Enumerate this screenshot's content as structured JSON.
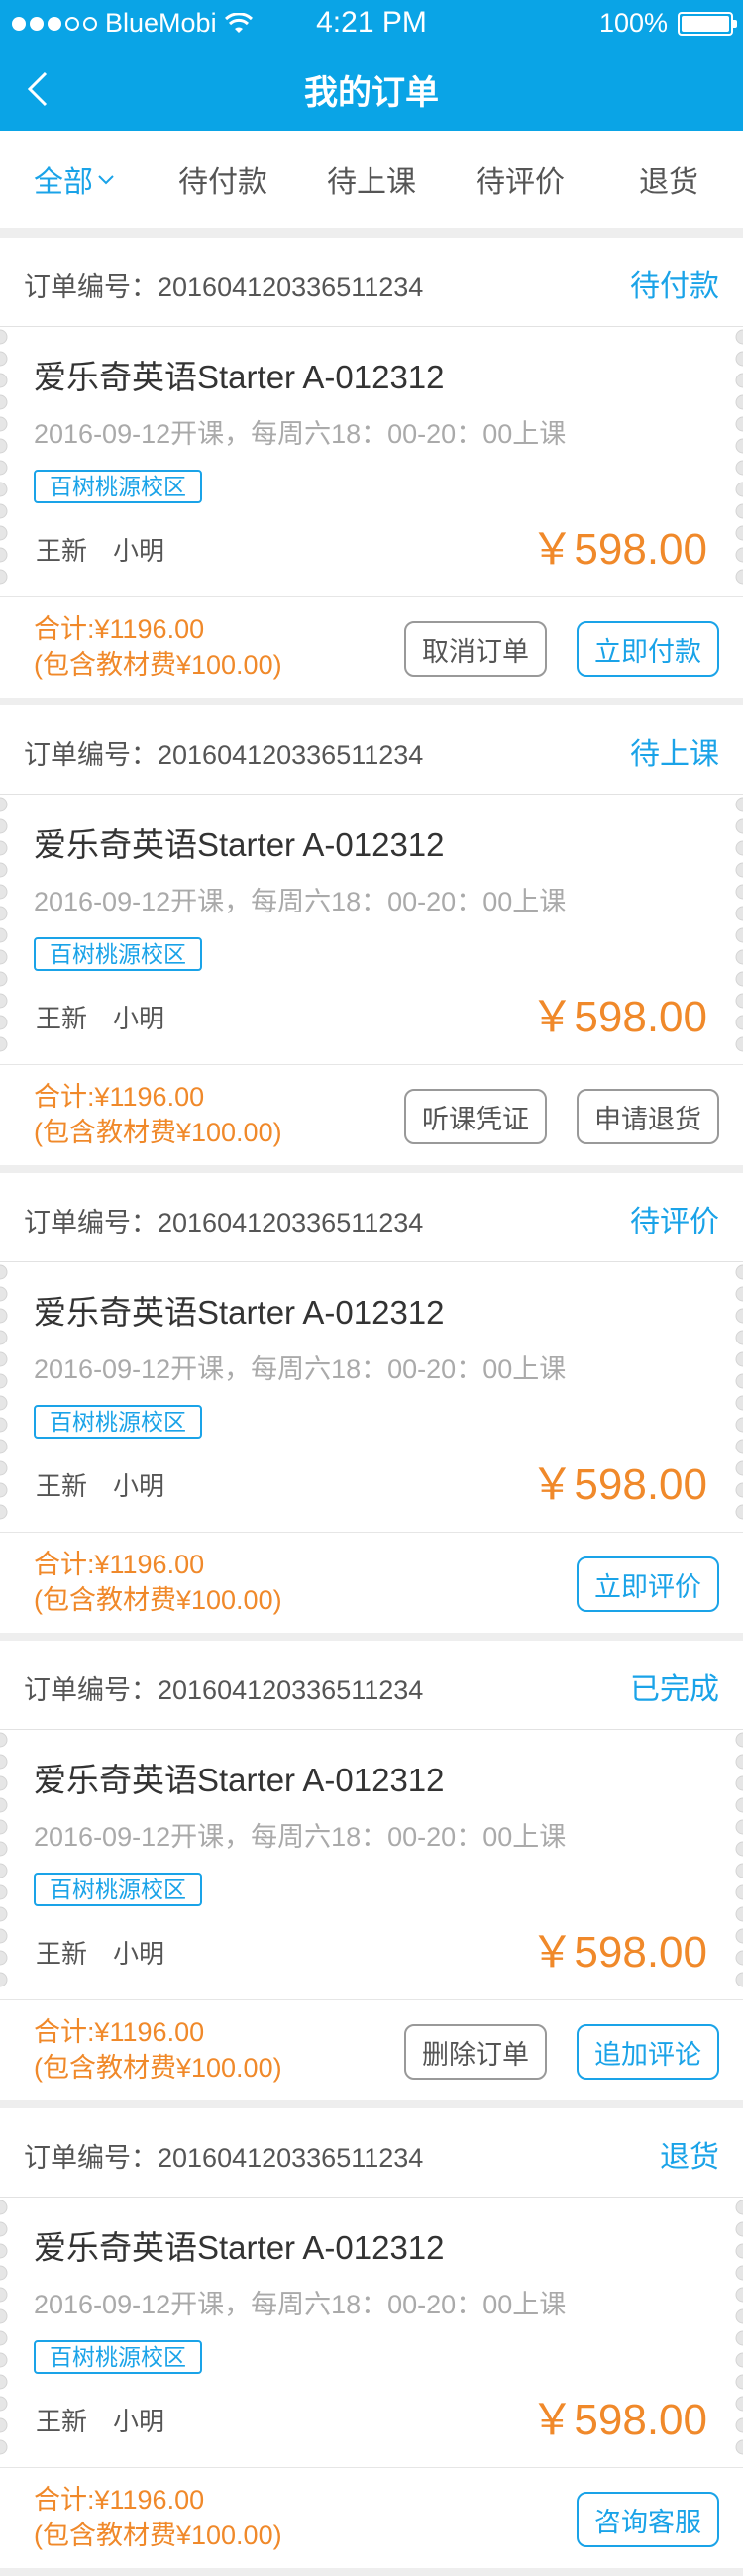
{
  "status_bar": {
    "carrier": "BlueMobi",
    "time": "4:21 PM",
    "battery": "100%"
  },
  "navbar": {
    "title": "我的订单"
  },
  "tabs": [
    {
      "label": "全部",
      "active": true
    },
    {
      "label": "待付款",
      "active": false
    },
    {
      "label": "待上课",
      "active": false
    },
    {
      "label": "待评价",
      "active": false
    },
    {
      "label": "退货",
      "active": false
    }
  ],
  "orders": [
    {
      "number_label": "订单编号：201604120336511234",
      "status": "待付款",
      "course": "爱乐奇英语Starter A-012312",
      "schedule": "2016-09-12开课，每周六18：00-20：00上课",
      "campus": "百树桃源校区",
      "teacher": "王新",
      "student": "小明",
      "price": "￥598.00",
      "total": "合计:¥1196.00",
      "material": "(包含教材费¥100.00)",
      "buttons": [
        {
          "label": "取消订单",
          "primary": false
        },
        {
          "label": "立即付款",
          "primary": true
        }
      ]
    },
    {
      "number_label": "订单编号：201604120336511234",
      "status": "待上课",
      "course": "爱乐奇英语Starter A-012312",
      "schedule": "2016-09-12开课，每周六18：00-20：00上课",
      "campus": "百树桃源校区",
      "teacher": "王新",
      "student": "小明",
      "price": "￥598.00",
      "total": "合计:¥1196.00",
      "material": "(包含教材费¥100.00)",
      "buttons": [
        {
          "label": "听课凭证",
          "primary": false
        },
        {
          "label": "申请退货",
          "primary": false
        }
      ]
    },
    {
      "number_label": "订单编号：201604120336511234",
      "status": "待评价",
      "course": "爱乐奇英语Starter A-012312",
      "schedule": "2016-09-12开课，每周六18：00-20：00上课",
      "campus": "百树桃源校区",
      "teacher": "王新",
      "student": "小明",
      "price": "￥598.00",
      "total": "合计:¥1196.00",
      "material": "(包含教材费¥100.00)",
      "buttons": [
        {
          "label": "立即评价",
          "primary": true
        }
      ]
    },
    {
      "number_label": "订单编号：201604120336511234",
      "status": "已完成",
      "course": "爱乐奇英语Starter A-012312",
      "schedule": "2016-09-12开课，每周六18：00-20：00上课",
      "campus": "百树桃源校区",
      "teacher": "王新",
      "student": "小明",
      "price": "￥598.00",
      "total": "合计:¥1196.00",
      "material": "(包含教材费¥100.00)",
      "buttons": [
        {
          "label": "删除订单",
          "primary": false
        },
        {
          "label": "追加评论",
          "primary": true
        }
      ]
    },
    {
      "number_label": "订单编号：201604120336511234",
      "status": "退货",
      "course": "爱乐奇英语Starter A-012312",
      "schedule": "2016-09-12开课，每周六18：00-20：00上课",
      "campus": "百树桃源校区",
      "teacher": "王新",
      "student": "小明",
      "price": "￥598.00",
      "total": "合计:¥1196.00",
      "material": "(包含教材费¥100.00)",
      "buttons": [
        {
          "label": "咨询客服",
          "primary": true
        }
      ]
    }
  ],
  "colors": {
    "header_bg": "#0aa4e6",
    "accent": "#1aa3e8",
    "price": "#f0892a"
  }
}
